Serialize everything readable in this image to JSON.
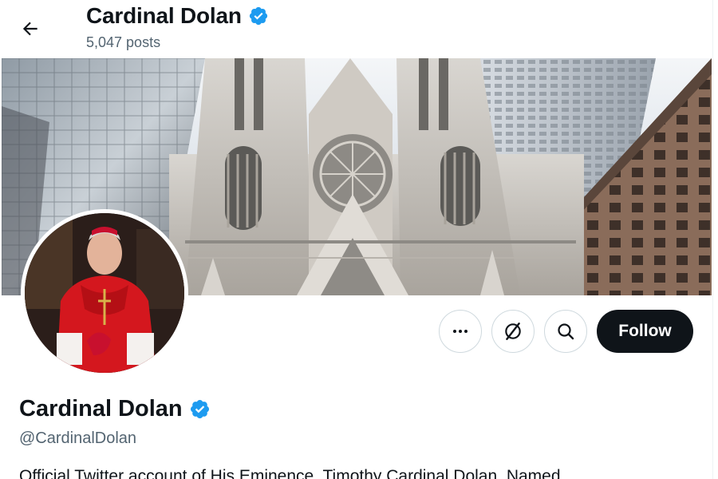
{
  "header": {
    "back_label": "Back",
    "name": "Cardinal Dolan",
    "posts": "5,047 posts"
  },
  "profile": {
    "display_name": "Cardinal Dolan",
    "handle": "@CardinalDolan",
    "bio": "Official Twitter account of His Eminence, Timothy Cardinal Dolan. Named",
    "verified": true
  },
  "actions": {
    "more_icon": "more-horizontal-icon",
    "grok_icon": "grok-icon",
    "search_icon": "search-icon",
    "follow_label": "Follow"
  },
  "colors": {
    "verified_badge": "#1d9bf0",
    "follow_button_bg": "#0f1419",
    "follow_button_text": "#ffffff",
    "secondary_text": "#536471"
  }
}
